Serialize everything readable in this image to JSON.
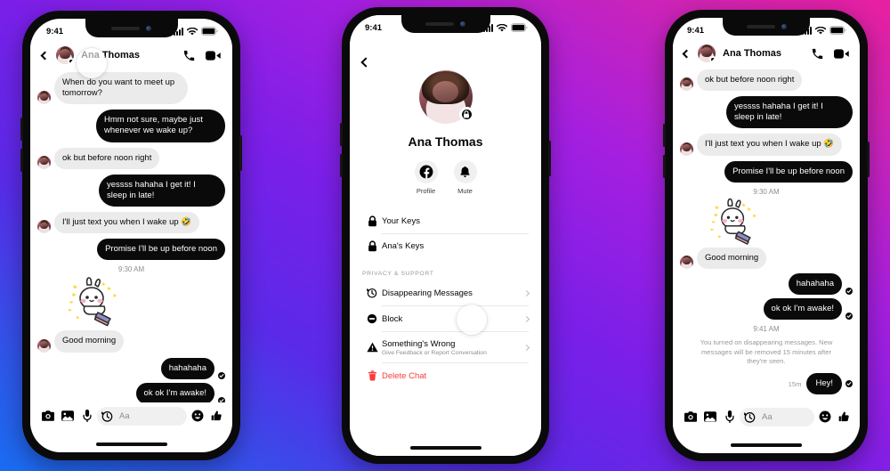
{
  "background": {
    "gradient_from": "#e81fa0",
    "gradient_mid": "#7a1fe8",
    "gradient_to": "#1a6cf0"
  },
  "phones": [
    {
      "id": "phone-chat-before",
      "status_bar": {
        "time": "9:41",
        "signal_icon": "cellular-bars-icon",
        "wifi_icon": "wifi-icon",
        "battery_icon": "battery-icon"
      },
      "header": {
        "back_icon": "back-chevron-icon",
        "avatar_name": "ana-avatar",
        "name": "Ana Thomas",
        "call_icon": "phone-call-icon",
        "video_icon": "video-call-icon"
      },
      "messages": [
        {
          "kind": "in",
          "text": "When do you want to meet up tomorrow?",
          "avatar": true
        },
        {
          "kind": "out",
          "text": "Hmm not sure, maybe just whenever we wake up?"
        },
        {
          "kind": "in",
          "text": "ok but before noon right",
          "avatar": true
        },
        {
          "kind": "out",
          "text": "yessss hahaha I get it! I sleep in late!"
        },
        {
          "kind": "in",
          "text": "I'll just text you when I wake up 🤣",
          "avatar": true
        },
        {
          "kind": "out",
          "text": "Promise I'll be up before noon"
        },
        {
          "kind": "time",
          "text": "9:30 AM"
        },
        {
          "kind": "sticker",
          "text": "bunny-sticker"
        },
        {
          "kind": "in",
          "text": "Good morning",
          "avatar": true
        },
        {
          "kind": "out",
          "text": "hahahaha",
          "seen": true
        },
        {
          "kind": "out",
          "text": "ok ok I'm awake!",
          "seen": true
        }
      ],
      "composer": {
        "camera_icon": "camera-icon",
        "gallery_icon": "photo-gallery-icon",
        "mic_icon": "microphone-icon",
        "timer_icon": "disappearing-timer-icon",
        "placeholder": "Aa",
        "emoji_icon": "emoji-smiley-icon",
        "like_icon": "thumbs-up-icon"
      }
    },
    {
      "id": "phone-settings",
      "status_bar": {
        "time": "9:41",
        "signal_icon": "cellular-bars-icon",
        "wifi_icon": "wifi-icon",
        "battery_icon": "battery-icon"
      },
      "header": {
        "back_icon": "back-chevron-icon"
      },
      "profile": {
        "avatar": "ana-large-avatar",
        "lock_badge_icon": "lock-icon",
        "name": "Ana Thomas",
        "actions": [
          {
            "icon": "facebook-icon",
            "label": "Profile"
          },
          {
            "icon": "bell-icon",
            "label": "Mute"
          }
        ]
      },
      "keys": [
        {
          "icon": "lock-icon",
          "label": "Your Keys"
        },
        {
          "icon": "lock-icon",
          "label": "Ana's Keys"
        }
      ],
      "section_title": "PRIVACY & SUPPORT",
      "options": [
        {
          "icon": "clock-history-icon",
          "label": "Disappearing Messages",
          "sub": "",
          "chevron": true,
          "danger": false
        },
        {
          "icon": "block-icon",
          "label": "Block",
          "sub": "",
          "chevron": true,
          "danger": false
        },
        {
          "icon": "warning-triangle-icon",
          "label": "Something's Wrong",
          "sub": "Give Feedback or Report Conversation",
          "chevron": true,
          "danger": false
        },
        {
          "icon": "trash-icon",
          "label": "Delete Chat",
          "sub": "",
          "chevron": false,
          "danger": true
        }
      ],
      "tap_target": "Disappearing Messages"
    },
    {
      "id": "phone-chat-after",
      "status_bar": {
        "time": "9:41",
        "signal_icon": "cellular-bars-icon",
        "wifi_icon": "wifi-icon",
        "battery_icon": "battery-icon"
      },
      "header": {
        "back_icon": "back-chevron-icon",
        "avatar_name": "ana-avatar",
        "name": "Ana Thomas",
        "call_icon": "phone-call-icon",
        "video_icon": "video-call-icon"
      },
      "messages": [
        {
          "kind": "in",
          "text": "ok but before noon right",
          "avatar": true
        },
        {
          "kind": "out",
          "text": "yessss hahaha I get it! I sleep in late!"
        },
        {
          "kind": "in",
          "text": "I'll just text you when I wake up 🤣",
          "avatar": true
        },
        {
          "kind": "out",
          "text": "Promise I'll be up before noon"
        },
        {
          "kind": "time",
          "text": "9:30 AM"
        },
        {
          "kind": "sticker",
          "text": "bunny-sticker"
        },
        {
          "kind": "in",
          "text": "Good morning",
          "avatar": true
        },
        {
          "kind": "out",
          "text": "hahahaha",
          "seen": true
        },
        {
          "kind": "out",
          "text": "ok ok I'm awake!",
          "seen": true
        },
        {
          "kind": "time",
          "text": "9:41 AM"
        },
        {
          "kind": "system",
          "text": "You turned on disappearing messages. New messages will be removed 15 minutes after they're seen."
        },
        {
          "kind": "out",
          "text": "Hey!",
          "seen": true,
          "ephemeral_label": "15m"
        }
      ],
      "composer": {
        "camera_icon": "camera-icon",
        "gallery_icon": "photo-gallery-icon",
        "mic_icon": "microphone-icon",
        "timer_icon": "disappearing-timer-icon",
        "placeholder": "Aa",
        "emoji_icon": "emoji-smiley-icon",
        "like_icon": "thumbs-up-icon"
      }
    }
  ]
}
